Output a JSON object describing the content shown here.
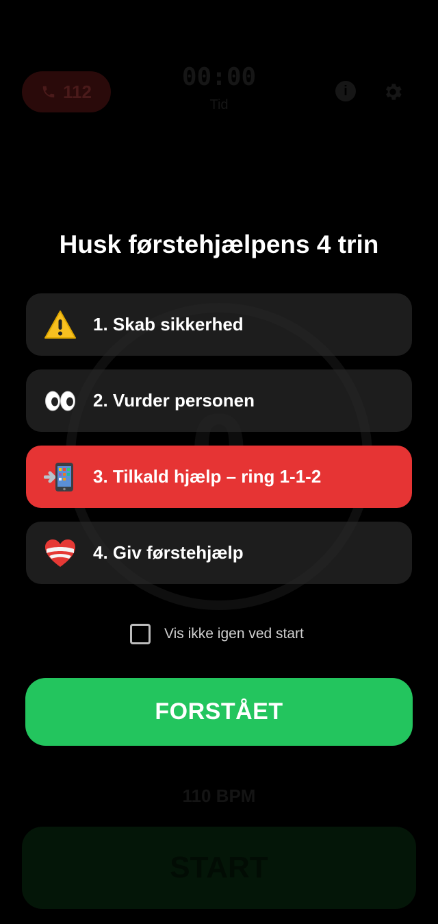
{
  "background": {
    "call_button_label": "112",
    "timer": "00:00",
    "timer_label": "Tid",
    "bpm_label": "110 BPM",
    "start_label": "START",
    "ring_number": "0"
  },
  "modal": {
    "title": "Husk førstehjælpens 4 trin",
    "steps": [
      {
        "icon": "warning-icon",
        "label": "1. Skab sikkerhed",
        "active": false
      },
      {
        "icon": "eyes-icon",
        "label": "2. Vurder personen",
        "active": false
      },
      {
        "icon": "phone-call-icon",
        "label": "3. Tilkald hjælp – ring 1-1-2",
        "active": true
      },
      {
        "icon": "bandaged-heart-icon",
        "label": "4. Giv førstehjælp",
        "active": false
      }
    ],
    "dont_show_again_label": "Vis ikke igen ved start",
    "dont_show_again_checked": false,
    "confirm_label": "FORSTÅET"
  },
  "colors": {
    "active_step": "#e63434",
    "confirm_button": "#23c55e",
    "step_background": "#282828"
  }
}
